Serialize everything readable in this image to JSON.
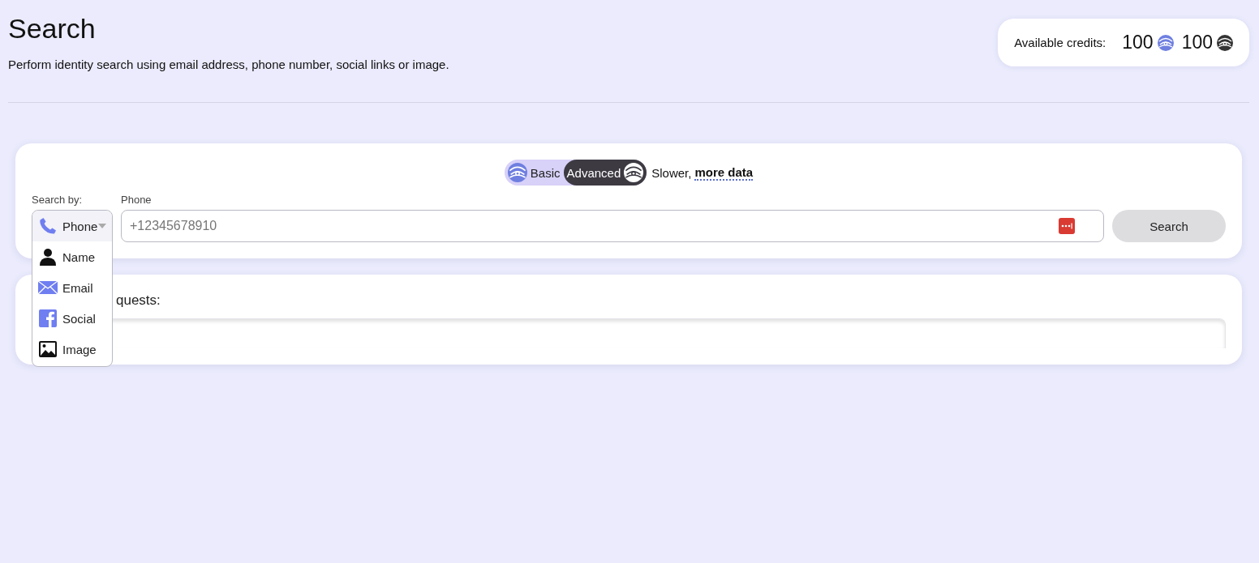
{
  "page": {
    "title": "Search",
    "subtitle": "Perform identity search using email address, phone number, social links or image."
  },
  "credits": {
    "label": "Available credits:",
    "items": [
      {
        "amount": "100",
        "kind": "basic"
      },
      {
        "amount": "100",
        "kind": "advanced"
      }
    ]
  },
  "search_card": {
    "mode_toggle": [
      {
        "label": "Basic",
        "kind": "basic",
        "selected": false
      },
      {
        "label": "Advanced",
        "kind": "advanced",
        "selected": true
      }
    ],
    "mode_note": "Slower,",
    "mode_link": "more data",
    "search_by": {
      "label": "Search by:",
      "options": [
        {
          "label": "Phone",
          "kind": "phone",
          "selected": true
        },
        {
          "label": "Name",
          "kind": "name",
          "selected": false
        },
        {
          "label": "Email",
          "kind": "email",
          "selected": false
        },
        {
          "label": "Social",
          "kind": "social",
          "selected": false
        },
        {
          "label": "Image",
          "kind": "image",
          "selected": false
        }
      ]
    },
    "field": {
      "label": "Phone",
      "placeholder": "+12345678910"
    },
    "button": "Search"
  },
  "requests_card": {
    "title": "quests:"
  }
}
